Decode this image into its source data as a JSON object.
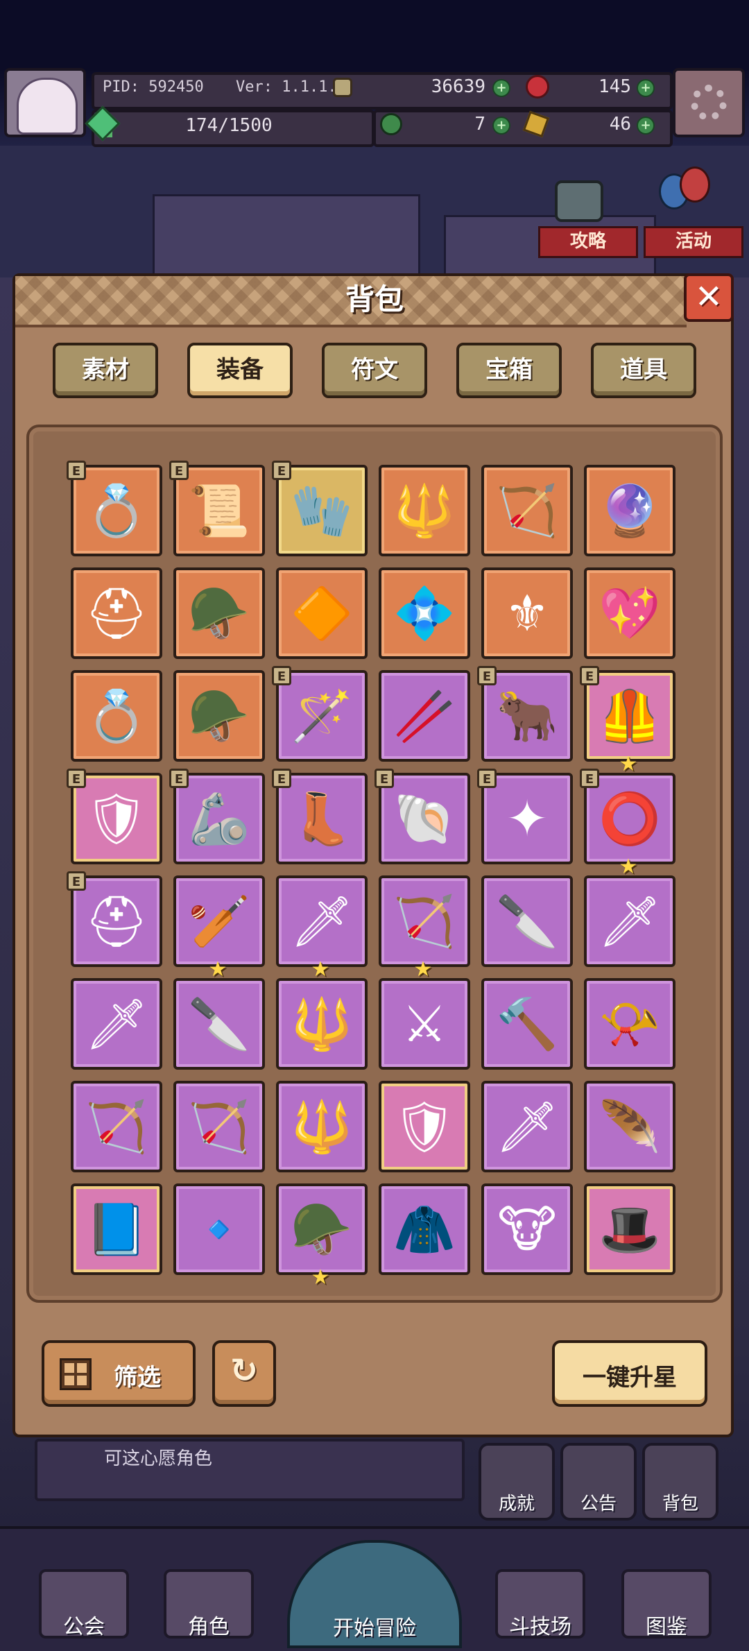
{
  "hud": {
    "pid_label": "PID: 592450",
    "version_label": "Ver: 1.1.1.3",
    "currency_gold": "36639",
    "currency_gem": "145",
    "exp_progress": "174/1500",
    "currency_clover": "7",
    "currency_key": "46"
  },
  "side_events": {
    "guide_label": "攻略",
    "activity_label": "活动"
  },
  "modal": {
    "title": "背包",
    "tabs": [
      {
        "label": "素材",
        "active": false
      },
      {
        "label": "装备",
        "active": true
      },
      {
        "label": "符文",
        "active": false
      },
      {
        "label": "宝箱",
        "active": false
      },
      {
        "label": "道具",
        "active": false
      }
    ],
    "filter_label": "筛选",
    "upgrade_all_label": "一键升星",
    "close_symbol": "✕",
    "refresh_symbol": "↻"
  },
  "inventory": [
    {
      "icon": "ring-icon",
      "glyph": "💍",
      "rarity": "orange",
      "equipped": true,
      "starred": false
    },
    {
      "icon": "scroll-icon",
      "glyph": "📜",
      "rarity": "orange",
      "equipped": true,
      "starred": false
    },
    {
      "icon": "glove-icon",
      "glyph": "🧤",
      "rarity": "gold",
      "equipped": true,
      "starred": false
    },
    {
      "icon": "wand-icon",
      "glyph": "🔱",
      "rarity": "orange",
      "equipped": false,
      "starred": false
    },
    {
      "icon": "crossbow-icon",
      "glyph": "🏹",
      "rarity": "orange",
      "equipped": false,
      "starred": false
    },
    {
      "icon": "orb-icon",
      "glyph": "🔮",
      "rarity": "orange",
      "equipped": false,
      "starred": false
    },
    {
      "icon": "hood-icon",
      "glyph": "⛑",
      "rarity": "orange",
      "equipped": false,
      "starred": false
    },
    {
      "icon": "green-hood-icon",
      "glyph": "🪖",
      "rarity": "orange",
      "equipped": false,
      "starred": false
    },
    {
      "icon": "gem-amulet-icon",
      "glyph": "🔶",
      "rarity": "orange",
      "equipped": false,
      "starred": false
    },
    {
      "icon": "flower-gem-icon",
      "glyph": "💠",
      "rarity": "orange",
      "equipped": false,
      "starred": false
    },
    {
      "icon": "shield-sword-icon",
      "glyph": "⚜",
      "rarity": "orange",
      "equipped": false,
      "starred": false
    },
    {
      "icon": "heart-necklace-icon",
      "glyph": "💖",
      "rarity": "orange",
      "equipped": false,
      "starred": false
    },
    {
      "icon": "gold-ring-icon",
      "glyph": "💍",
      "rarity": "orange",
      "equipped": false,
      "starred": false
    },
    {
      "icon": "helmet-icon",
      "glyph": "🪖",
      "rarity": "orange",
      "equipped": false,
      "starred": false
    },
    {
      "icon": "staff-icon",
      "glyph": "🪄",
      "rarity": "purple",
      "equipped": true,
      "starred": false
    },
    {
      "icon": "stick-icon",
      "glyph": "🥢",
      "rarity": "purple",
      "equipped": false,
      "starred": false
    },
    {
      "icon": "bull-armor-icon",
      "glyph": "🐂",
      "rarity": "purple",
      "equipped": true,
      "starred": false
    },
    {
      "icon": "heart-armor-icon",
      "glyph": "🦺",
      "rarity": "pink",
      "equipped": true,
      "starred": true
    },
    {
      "icon": "plate-armor-icon",
      "glyph": "🛡",
      "rarity": "pink",
      "equipped": true,
      "starred": false
    },
    {
      "icon": "pauldron-icon",
      "glyph": "🦾",
      "rarity": "purple",
      "equipped": true,
      "starred": false
    },
    {
      "icon": "boots-icon",
      "glyph": "👢",
      "rarity": "purple",
      "equipped": true,
      "starred": false
    },
    {
      "icon": "shell-charm-icon",
      "glyph": "🐚",
      "rarity": "purple",
      "equipped": true,
      "starred": false
    },
    {
      "icon": "star-charm-icon",
      "glyph": "✦",
      "rarity": "purple",
      "equipped": true,
      "starred": false
    },
    {
      "icon": "stone-ring-icon",
      "glyph": "⭕",
      "rarity": "purple",
      "equipped": true,
      "starred": true
    },
    {
      "icon": "visor-helmet-icon",
      "glyph": "⛑",
      "rarity": "purple",
      "equipped": true,
      "starred": false
    },
    {
      "icon": "mace-icon",
      "glyph": "🏏",
      "rarity": "purple",
      "equipped": false,
      "starred": true
    },
    {
      "icon": "golden-sword-icon",
      "glyph": "🗡",
      "rarity": "purple",
      "equipped": false,
      "starred": true
    },
    {
      "icon": "bow-icon",
      "glyph": "🏹",
      "rarity": "purple",
      "equipped": false,
      "starred": true
    },
    {
      "icon": "cleaver-icon",
      "glyph": "🔪",
      "rarity": "purple",
      "equipped": false,
      "starred": false
    },
    {
      "icon": "short-sword-icon",
      "glyph": "🗡",
      "rarity": "purple",
      "equipped": false,
      "starred": false
    },
    {
      "icon": "dark-sword-icon",
      "glyph": "🗡",
      "rarity": "purple",
      "equipped": false,
      "starred": false
    },
    {
      "icon": "dagger-icon",
      "glyph": "🔪",
      "rarity": "purple",
      "equipped": false,
      "starred": false
    },
    {
      "icon": "spear-icon",
      "glyph": "🔱",
      "rarity": "purple",
      "equipped": false,
      "starred": false
    },
    {
      "icon": "broadsword-icon",
      "glyph": "⚔",
      "rarity": "purple",
      "equipped": false,
      "starred": false
    },
    {
      "icon": "hammer-icon",
      "glyph": "🔨",
      "rarity": "purple",
      "equipped": false,
      "starred": false
    },
    {
      "icon": "horn-icon",
      "glyph": "📯",
      "rarity": "purple",
      "equipped": false,
      "starred": false
    },
    {
      "icon": "recurve-bow-icon",
      "glyph": "🏹",
      "rarity": "purple",
      "equipped": false,
      "starred": false
    },
    {
      "icon": "crossbow-silver-icon",
      "glyph": "🏹",
      "rarity": "purple",
      "equipped": false,
      "starred": false
    },
    {
      "icon": "lance-icon",
      "glyph": "🔱",
      "rarity": "purple",
      "equipped": false,
      "starred": false
    },
    {
      "icon": "round-shield-icon",
      "glyph": "🛡",
      "rarity": "pink",
      "equipped": false,
      "starred": false
    },
    {
      "icon": "orange-dagger-icon",
      "glyph": "🗡",
      "rarity": "purple",
      "equipped": false,
      "starred": false
    },
    {
      "icon": "feather-dagger-icon",
      "glyph": "🪶",
      "rarity": "purple",
      "equipped": false,
      "starred": false
    },
    {
      "icon": "spellbook-icon",
      "glyph": "📘",
      "rarity": "pink",
      "equipped": false,
      "starred": false
    },
    {
      "icon": "blue-arrow-icon",
      "glyph": "🔹",
      "rarity": "purple",
      "equipped": false,
      "starred": false
    },
    {
      "icon": "barrel-helmet-icon",
      "glyph": "🪖",
      "rarity": "purple",
      "equipped": false,
      "starred": true
    },
    {
      "icon": "green-cloak-icon",
      "glyph": "🧥",
      "rarity": "purple",
      "equipped": false,
      "starred": false
    },
    {
      "icon": "bull-skull-icon",
      "glyph": "🐮",
      "rarity": "purple",
      "equipped": false,
      "starred": false
    },
    {
      "icon": "black-hat-icon",
      "glyph": "🎩",
      "rarity": "pink",
      "equipped": false,
      "starred": false
    }
  ],
  "bottom_shortcuts": {
    "achievement_label": "成就",
    "notice_label": "公告",
    "backpack_label": "背包"
  },
  "bottom_nav": [
    {
      "label": "公会",
      "icon": "guild-icon"
    },
    {
      "label": "角色",
      "icon": "character-icon"
    },
    {
      "label": "开始冒险",
      "icon": "magnifier-icon"
    },
    {
      "label": "斗技场",
      "icon": "arena-icon"
    },
    {
      "label": "图鉴",
      "icon": "codex-icon"
    }
  ],
  "background_notice": "可这心愿角色"
}
